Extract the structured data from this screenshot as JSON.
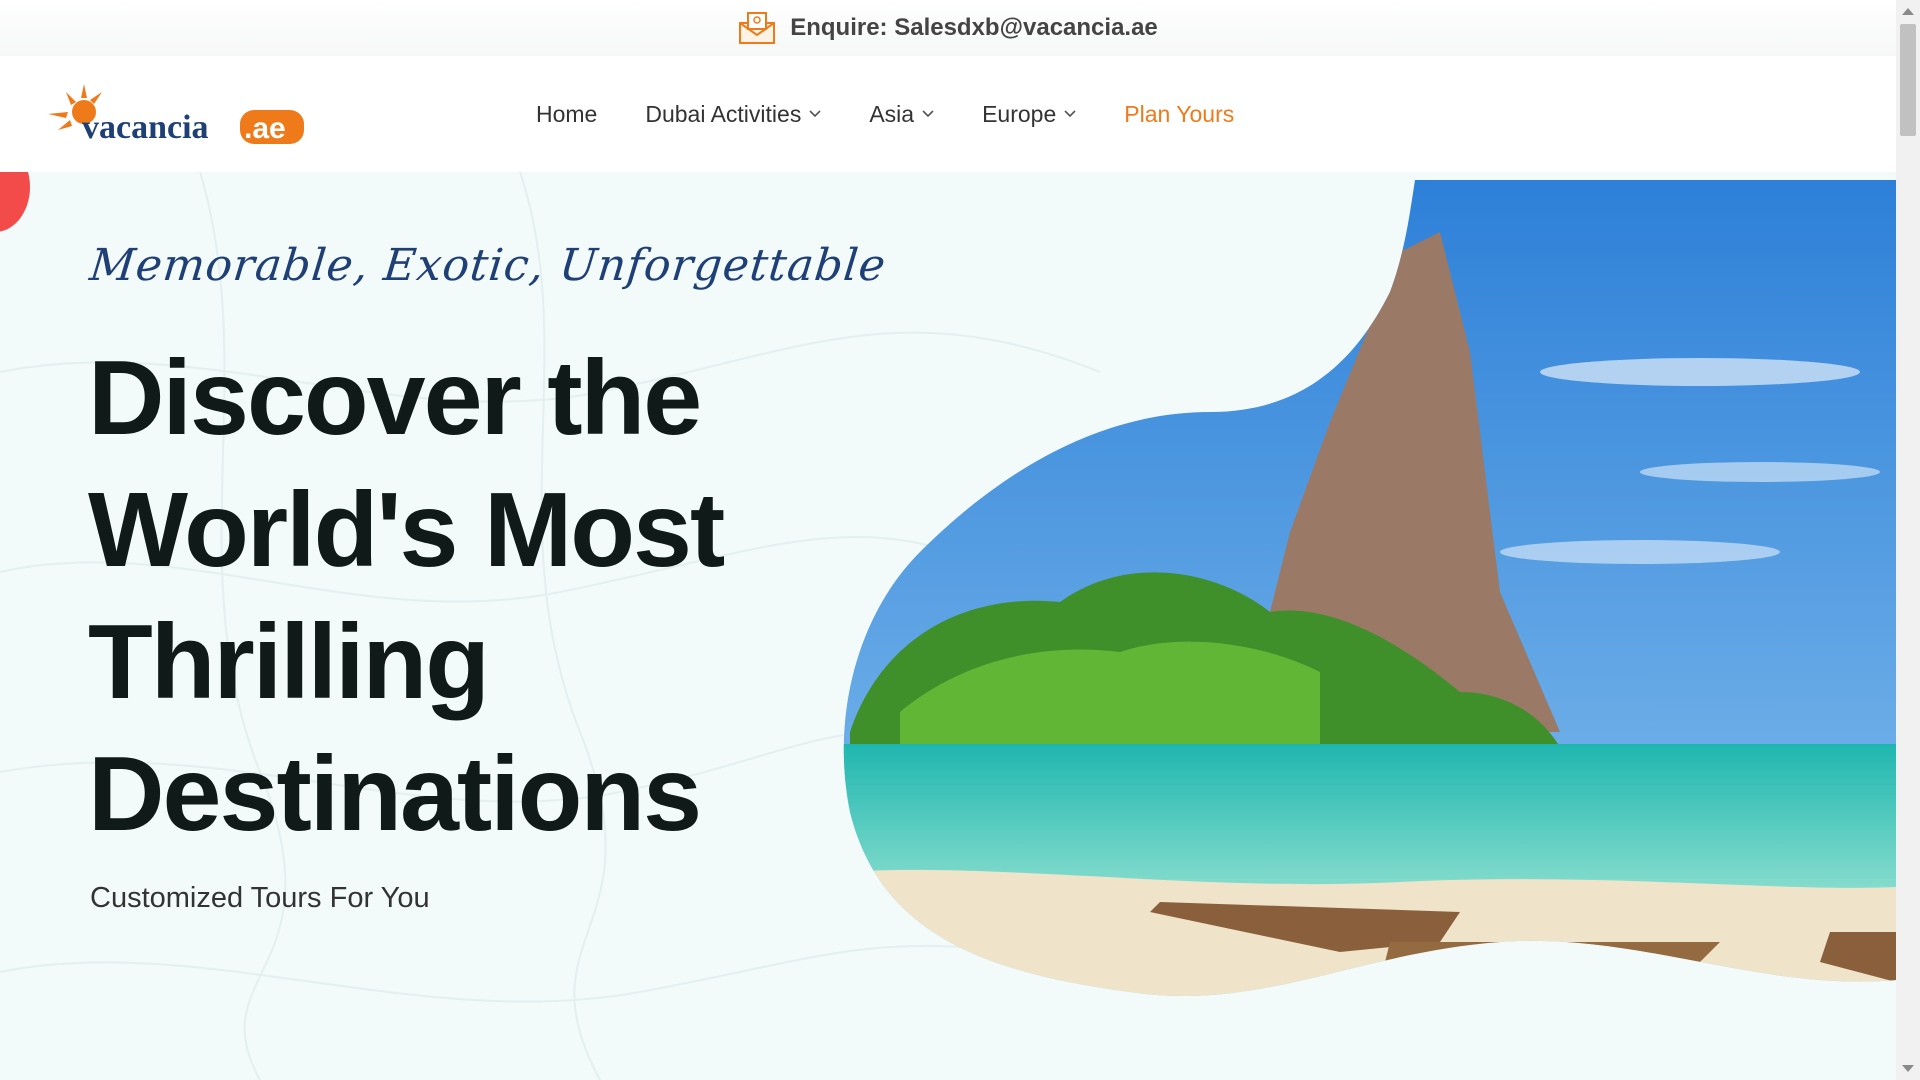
{
  "topbar": {
    "enquire_text": "Enquire: Salesdxb@vacancia.ae",
    "icon": "mail-icon"
  },
  "header": {
    "logo": {
      "text_main": "vacancia",
      "text_suffix": ".ae",
      "icon": "sun-logo-icon"
    },
    "nav": [
      {
        "label": "Home",
        "has_dropdown": false
      },
      {
        "label": "Dubai Activities",
        "has_dropdown": true
      },
      {
        "label": "Asia",
        "has_dropdown": true
      },
      {
        "label": "Europe",
        "has_dropdown": true
      },
      {
        "label": "Plan Yours",
        "has_dropdown": false
      }
    ]
  },
  "hero": {
    "tagline": "Memorable, Exotic, Unforgettable",
    "headline_lines": [
      "Discover the",
      "World's Most",
      "Thrilling",
      "Destinations"
    ],
    "subline": "Customized Tours For You",
    "image": "thailand-beach-longtail-boats"
  },
  "colors": {
    "accent": "#ef7a1a",
    "brand_blue": "#1f3f77",
    "hero_bg": "#f2fafa",
    "headline": "#101a18"
  }
}
